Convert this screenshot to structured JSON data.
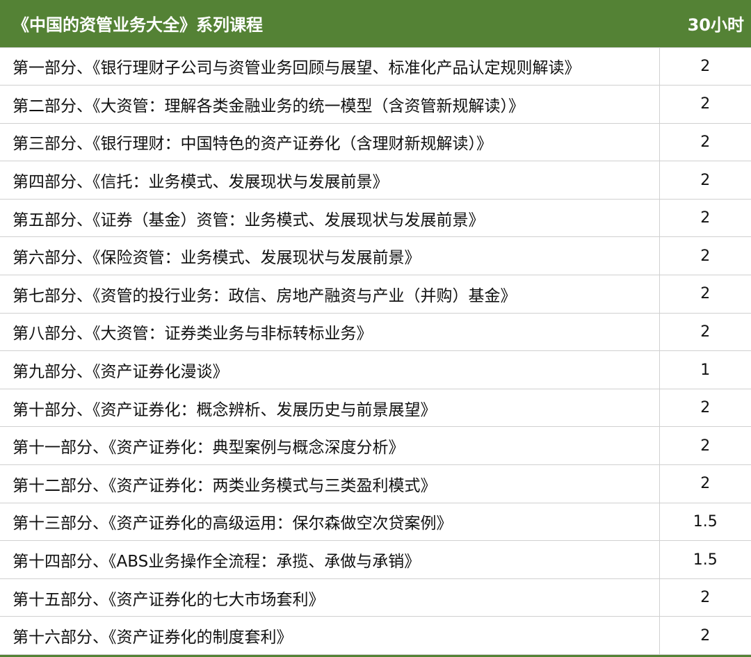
{
  "header": {
    "title": "《中国的资管业务大全》系列课程",
    "hours": "30小时"
  },
  "colors": {
    "header_bg": "#548235",
    "header_text": "#ffffff",
    "grid": "#d0d0d0"
  },
  "rows": [
    {
      "title": "第一部分、《银行理财子公司与资管业务回顾与展望、标准化产品认定规则解读》",
      "hours": "2"
    },
    {
      "title": "第二部分、《大资管：理解各类金融业务的统一模型（含资管新规解读）》",
      "hours": "2"
    },
    {
      "title": "第三部分、《银行理财：中国特色的资产证券化（含理财新规解读）》",
      "hours": "2"
    },
    {
      "title": "第四部分、《信托：业务模式、发展现状与发展前景》",
      "hours": "2"
    },
    {
      "title": "第五部分、《证券（基金）资管：业务模式、发展现状与发展前景》",
      "hours": "2"
    },
    {
      "title": "第六部分、《保险资管：业务模式、发展现状与发展前景》",
      "hours": "2"
    },
    {
      "title": "第七部分、《资管的投行业务：政信、房地产融资与产业（并购）基金》",
      "hours": "2"
    },
    {
      "title": "第八部分、《大资管：证券类业务与非标转标业务》",
      "hours": "2"
    },
    {
      "title": "第九部分、《资产证券化漫谈》",
      "hours": "1"
    },
    {
      "title": "第十部分、《资产证券化：概念辨析、发展历史与前景展望》",
      "hours": "2"
    },
    {
      "title": "第十一部分、《资产证券化：典型案例与概念深度分析》",
      "hours": "2"
    },
    {
      "title": "第十二部分、《资产证券化：两类业务模式与三类盈利模式》",
      "hours": "2"
    },
    {
      "title": "第十三部分、《资产证券化的高级运用：保尔森做空次贷案例》",
      "hours": "1.5"
    },
    {
      "title": "第十四部分、《ABS业务操作全流程：承揽、承做与承销》",
      "hours": "1.5"
    },
    {
      "title": "第十五部分、《资产证券化的七大市场套利》",
      "hours": "2"
    },
    {
      "title": "第十六部分、《资产证券化的制度套利》",
      "hours": "2"
    }
  ]
}
